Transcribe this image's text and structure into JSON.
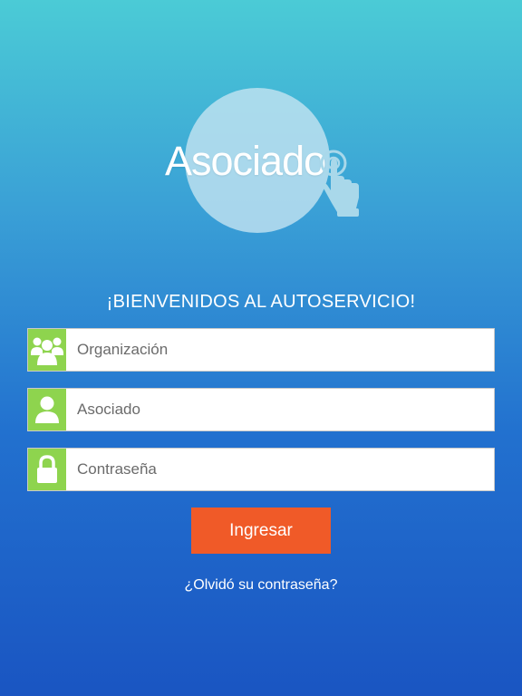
{
  "logo": {
    "text": "Asociado"
  },
  "welcome": "¡BIENVENIDOS AL AUTOSERVICIO!",
  "fields": {
    "organization": {
      "placeholder": "Organización",
      "icon": "users-group-icon"
    },
    "associate": {
      "placeholder": "Asociado",
      "icon": "user-icon"
    },
    "password": {
      "placeholder": "Contraseña",
      "icon": "lock-icon"
    }
  },
  "login_button": "Ingresar",
  "forgot_link": "¿Olvidó su contraseña?",
  "colors": {
    "icon_box": "#8ed44e",
    "button": "#f05a28",
    "background_top": "#4bcbd6",
    "background_bottom": "#1a55c2"
  }
}
